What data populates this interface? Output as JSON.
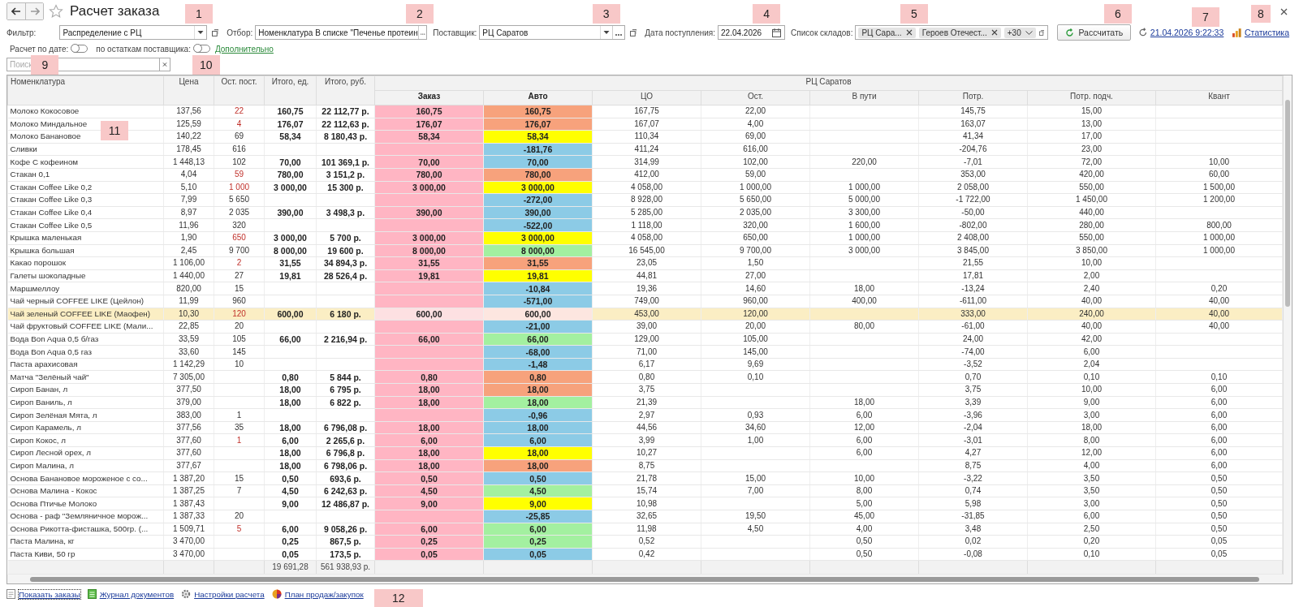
{
  "window": {
    "title": "Расчет заказа"
  },
  "filters": [
    {
      "label": "Фильтр:",
      "value": "Распределение с РЦ",
      "kind": "select"
    },
    {
      "label": "Отбор:",
      "value": "Номенклатура В списке \"Печенье протеин",
      "kind": "picker"
    },
    {
      "label": "Поставщик:",
      "value": "РЦ Саратов",
      "kind": "select_picker"
    },
    {
      "label": "Дата поступления:",
      "value": "22.04.2026",
      "kind": "date"
    }
  ],
  "warehouses": {
    "label": "Список складов:",
    "tags": [
      "РЦ Сара...",
      "Героев Отечест..."
    ],
    "more": "+30"
  },
  "calculate_button": "Рассчитать",
  "last_calc": "21.04.2026 9:22:33",
  "statistics_link": "Статистика",
  "options": [
    {
      "label": "Расчет по дате:",
      "on": false
    },
    {
      "label": "по остаткам поставщика:",
      "on": false
    }
  ],
  "more_link": "Дополнительно",
  "search": {
    "placeholder": "Поиск"
  },
  "table": {
    "columns": [
      "Номенклатура",
      "Цена",
      "Ост. пост.",
      "Итого, ед.",
      "Итого, руб.",
      "Заказ",
      "Авто",
      "ЦО",
      "Ост.",
      "В пути",
      "Потр.",
      "Потр. подч.",
      "Квант"
    ],
    "group": "РЦ Саратов",
    "rows": [
      {
        "name": "Молоко Кокосовое",
        "price": "137,56",
        "stock": {
          "text": "22",
          "low": true
        },
        "qty": "160,75",
        "sum": "22 112,77 р.",
        "order": "160,75",
        "auto": {
          "text": "160,75",
          "color": "#f7a27c"
        },
        "co": "167,75",
        "rest": "22,00",
        "need": "145,75",
        "need_sub": "15,00",
        "selected": false
      },
      {
        "name": "Молоко Миндальное",
        "price": "125,59",
        "stock": {
          "text": "4",
          "low": true
        },
        "qty": "176,07",
        "sum": "22 112,63 р.",
        "order": "176,07",
        "auto": {
          "text": "176,07",
          "color": "#f7a27c"
        },
        "co": "167,07",
        "rest": "4,00",
        "need": "163,07",
        "need_sub": "13,00",
        "selected": false
      },
      {
        "name": "Молоко Банановое",
        "price": "140,22",
        "stock": {
          "text": "69",
          "low": false
        },
        "qty": "58,34",
        "sum": "8 180,43 р.",
        "order": "58,34",
        "auto": {
          "text": "58,34",
          "color": "#ffff00"
        },
        "co": "110,34",
        "rest": "69,00",
        "need": "41,34",
        "need_sub": "17,00",
        "selected": false
      },
      {
        "name": "Сливки",
        "price": "178,45",
        "stock": {
          "text": "616",
          "low": false
        },
        "auto": {
          "text": "-181,76",
          "color": "#8ccbe6"
        },
        "co": "411,24",
        "rest": "616,00",
        "need": "-204,76",
        "need_sub": "23,00",
        "selected": false
      },
      {
        "name": "Кофе С кофеином",
        "price": "1 448,13",
        "stock": {
          "text": "102",
          "low": false
        },
        "qty": "70,00",
        "sum": "101 369,1 р.",
        "order": "70,00",
        "auto": {
          "text": "70,00",
          "color": "#8ccbe6"
        },
        "co": "314,99",
        "rest": "102,00",
        "transit": "220,00",
        "need": "-7,01",
        "need_sub": "72,00",
        "quant": "10,00",
        "selected": false
      },
      {
        "name": "Стакан 0,1",
        "price": "4,04",
        "stock": {
          "text": "59",
          "low": true
        },
        "qty": "780,00",
        "sum": "3 151,2 р.",
        "order": "780,00",
        "auto": {
          "text": "780,00",
          "color": "#f7a27c"
        },
        "co": "412,00",
        "rest": "59,00",
        "need": "353,00",
        "need_sub": "420,00",
        "quant": "60,00",
        "selected": false
      },
      {
        "name": "Стакан Coffee Like 0,2",
        "price": "5,10",
        "stock": {
          "text": "1 000",
          "low": true
        },
        "qty": "3 000,00",
        "sum": "15 300 р.",
        "order": "3 000,00",
        "auto": {
          "text": "3 000,00",
          "color": "#ffff00"
        },
        "co": "4 058,00",
        "rest": "1 000,00",
        "transit": "1 000,00",
        "need": "2 058,00",
        "need_sub": "550,00",
        "quant": "1 500,00",
        "selected": false
      },
      {
        "name": "Стакан Coffee Like 0,3",
        "price": "7,99",
        "stock": {
          "text": "5 650",
          "low": false
        },
        "auto": {
          "text": "-272,00",
          "color": "#8ccbe6"
        },
        "co": "8 928,00",
        "rest": "5 650,00",
        "transit": "5 000,00",
        "need": "-1 722,00",
        "need_sub": "1 450,00",
        "quant": "1 200,00",
        "selected": false
      },
      {
        "name": "Стакан Coffee Like 0,4",
        "price": "8,97",
        "stock": {
          "text": "2 035",
          "low": false
        },
        "qty": "390,00",
        "sum": "3 498,3 р.",
        "order": "390,00",
        "auto": {
          "text": "390,00",
          "color": "#8ccbe6"
        },
        "co": "5 285,00",
        "rest": "2 035,00",
        "transit": "3 300,00",
        "need": "-50,00",
        "need_sub": "440,00",
        "selected": false
      },
      {
        "name": "Стакан Coffee Like 0,5",
        "price": "11,96",
        "stock": {
          "text": "320",
          "low": false
        },
        "auto": {
          "text": "-522,00",
          "color": "#8ccbe6"
        },
        "co": "1 118,00",
        "rest": "320,00",
        "transit": "1 600,00",
        "need": "-802,00",
        "need_sub": "280,00",
        "quant": "800,00",
        "selected": false
      },
      {
        "name": "Крышка маленькая",
        "price": "1,90",
        "stock": {
          "text": "650",
          "low": true
        },
        "qty": "3 000,00",
        "sum": "5 700 р.",
        "order": "3 000,00",
        "auto": {
          "text": "3 000,00",
          "color": "#ffff00"
        },
        "co": "4 058,00",
        "rest": "650,00",
        "transit": "1 000,00",
        "need": "2 408,00",
        "need_sub": "550,00",
        "quant": "1 000,00",
        "selected": false
      },
      {
        "name": "Крышка большая",
        "price": "2,45",
        "stock": {
          "text": "9 700",
          "low": false
        },
        "qty": "8 000,00",
        "sum": "19 600 р.",
        "order": "8 000,00",
        "auto": {
          "text": "8 000,00",
          "color": "#a3f0a0"
        },
        "co": "16 545,00",
        "rest": "9 700,00",
        "transit": "3 000,00",
        "need": "3 845,00",
        "need_sub": "3 850,00",
        "quant": "1 000,00",
        "selected": false
      },
      {
        "name": "Какао порошок",
        "price": "1 106,00",
        "stock": {
          "text": "2",
          "low": true
        },
        "qty": "31,55",
        "sum": "34 894,3 р.",
        "order": "31,55",
        "auto": {
          "text": "31,55",
          "color": "#f7a27c"
        },
        "co": "23,05",
        "rest": "1,50",
        "need": "21,55",
        "need_sub": "10,00",
        "selected": false
      },
      {
        "name": "Галеты шоколадные",
        "price": "1 440,00",
        "stock": {
          "text": "27",
          "low": false
        },
        "qty": "19,81",
        "sum": "28 526,4 р.",
        "order": "19,81",
        "auto": {
          "text": "19,81",
          "color": "#ffff00"
        },
        "co": "44,81",
        "rest": "27,00",
        "need": "17,81",
        "need_sub": "2,00",
        "selected": false
      },
      {
        "name": "Маршмеллоу",
        "price": "820,00",
        "stock": {
          "text": "15",
          "low": false
        },
        "auto": {
          "text": "-10,84",
          "color": "#8ccbe6"
        },
        "co": "19,36",
        "rest": "14,60",
        "transit": "18,00",
        "need": "-13,24",
        "need_sub": "2,40",
        "quant": "0,20",
        "selected": false
      },
      {
        "name": "Чай черный COFFEE LIKE (Цейлон)",
        "price": "11,99",
        "stock": {
          "text": "960",
          "low": false
        },
        "auto": {
          "text": "-571,00",
          "color": "#8ccbe6"
        },
        "co": "749,00",
        "rest": "960,00",
        "transit": "400,00",
        "need": "-611,00",
        "need_sub": "40,00",
        "quant": "40,00",
        "selected": false
      },
      {
        "name": "Чай зеленый COFFEE LIKE (Маофен)",
        "price": "10,30",
        "stock": {
          "text": "120",
          "low": true
        },
        "qty": "600,00",
        "sum": "6 180 р.",
        "order": "600,00",
        "auto": {
          "text": "600,00"
        },
        "co": "453,00",
        "rest": "120,00",
        "need": "333,00",
        "need_sub": "240,00",
        "quant": "40,00",
        "selected": true
      },
      {
        "name": "Чай фруктовый COFFEE LIKE (Мали...",
        "price": "22,85",
        "stock": {
          "text": "20",
          "low": false
        },
        "auto": {
          "text": "-21,00",
          "color": "#8ccbe6"
        },
        "co": "39,00",
        "rest": "20,00",
        "transit": "80,00",
        "need": "-61,00",
        "need_sub": "40,00",
        "quant": "40,00",
        "selected": false
      },
      {
        "name": "Вода Bon Aqua 0,5 б/газ",
        "price": "33,59",
        "stock": {
          "text": "105",
          "low": false
        },
        "qty": "66,00",
        "sum": "2 216,94 р.",
        "order": "66,00",
        "auto": {
          "text": "66,00",
          "color": "#a3f0a0"
        },
        "co": "129,00",
        "rest": "105,00",
        "need": "24,00",
        "need_sub": "42,00",
        "selected": false
      },
      {
        "name": "Вода Bon Aqua 0,5 газ",
        "price": "33,60",
        "stock": {
          "text": "145",
          "low": false
        },
        "auto": {
          "text": "-68,00",
          "color": "#8ccbe6"
        },
        "co": "71,00",
        "rest": "145,00",
        "need": "-74,00",
        "need_sub": "6,00",
        "selected": false
      },
      {
        "name": "Паста арахисовая",
        "price": "1 142,29",
        "stock": {
          "text": "10",
          "low": false
        },
        "auto": {
          "text": "-1,48",
          "color": "#8ccbe6"
        },
        "co": "6,17",
        "rest": "9,69",
        "need": "-3,52",
        "need_sub": "2,04",
        "selected": false
      },
      {
        "name": "Матча \"Зелёный чай\"",
        "price": "7 305,00",
        "qty": "0,80",
        "sum": "5 844 р.",
        "order": "0,80",
        "auto": {
          "text": "0,80",
          "color": "#f7a27c"
        },
        "co": "0,80",
        "rest": "0,10",
        "need": "0,70",
        "need_sub": "0,10",
        "quant": "0,10",
        "selected": false
      },
      {
        "name": "Сироп Банан, л",
        "price": "377,50",
        "qty": "18,00",
        "sum": "6 795 р.",
        "order": "18,00",
        "auto": {
          "text": "18,00",
          "color": "#f7a27c"
        },
        "co": "3,75",
        "need": "3,75",
        "need_sub": "10,00",
        "quant": "6,00",
        "selected": false
      },
      {
        "name": "Сироп Ваниль, л",
        "price": "379,00",
        "qty": "18,00",
        "sum": "6 822 р.",
        "order": "18,00",
        "auto": {
          "text": "18,00",
          "color": "#a3f0a0"
        },
        "co": "21,39",
        "transit": "18,00",
        "need": "3,39",
        "need_sub": "9,00",
        "quant": "6,00",
        "selected": false
      },
      {
        "name": "Сироп Зелёная Мята, л",
        "price": "383,00",
        "stock": {
          "text": "1",
          "low": false
        },
        "auto": {
          "text": "-0,96",
          "color": "#8ccbe6"
        },
        "co": "2,97",
        "rest": "0,93",
        "transit": "6,00",
        "need": "-3,96",
        "need_sub": "3,00",
        "quant": "6,00",
        "selected": false
      },
      {
        "name": "Сироп Карамель, л",
        "price": "377,56",
        "stock": {
          "text": "35",
          "low": false
        },
        "qty": "18,00",
        "sum": "6 796,08 р.",
        "order": "18,00",
        "auto": {
          "text": "18,00",
          "color": "#8ccbe6"
        },
        "co": "44,56",
        "rest": "34,60",
        "transit": "12,00",
        "need": "-2,04",
        "need_sub": "18,00",
        "quant": "6,00",
        "selected": false
      },
      {
        "name": "Сироп Кокос, л",
        "price": "377,60",
        "stock": {
          "text": "1",
          "low": true
        },
        "qty": "6,00",
        "sum": "2 265,6 р.",
        "order": "6,00",
        "auto": {
          "text": "6,00",
          "color": "#8ccbe6"
        },
        "co": "3,99",
        "rest": "1,00",
        "transit": "6,00",
        "need": "-3,01",
        "need_sub": "8,00",
        "quant": "6,00",
        "selected": false
      },
      {
        "name": "Сироп Лесной орех, л",
        "price": "377,60",
        "qty": "18,00",
        "sum": "6 796,8 р.",
        "order": "18,00",
        "auto": {
          "text": "18,00",
          "color": "#ffff00"
        },
        "co": "10,27",
        "transit": "6,00",
        "need": "4,27",
        "need_sub": "12,00",
        "quant": "6,00",
        "selected": false
      },
      {
        "name": "Сироп Малина, л",
        "price": "377,67",
        "qty": "18,00",
        "sum": "6 798,06 р.",
        "order": "18,00",
        "auto": {
          "text": "18,00",
          "color": "#f7a27c"
        },
        "co": "8,75",
        "need": "8,75",
        "need_sub": "4,00",
        "quant": "6,00",
        "selected": false
      },
      {
        "name": "Основа Банановое мороженое с со...",
        "price": "1 387,20",
        "stock": {
          "text": "15",
          "low": false
        },
        "qty": "0,50",
        "sum": "693,6 р.",
        "order": "0,50",
        "auto": {
          "text": "0,50",
          "color": "#8ccbe6"
        },
        "co": "21,78",
        "rest": "15,00",
        "transit": "10,00",
        "need": "-3,22",
        "need_sub": "3,50",
        "quant": "0,50",
        "selected": false
      },
      {
        "name": "Основа Малина - Кокос",
        "price": "1 387,25",
        "stock": {
          "text": "7",
          "low": false
        },
        "qty": "4,50",
        "sum": "6 242,63 р.",
        "order": "4,50",
        "auto": {
          "text": "4,50",
          "color": "#a3f0a0"
        },
        "co": "15,74",
        "rest": "7,00",
        "transit": "8,00",
        "need": "0,74",
        "need_sub": "3,50",
        "quant": "0,50",
        "selected": false
      },
      {
        "name": "Основа Птичье Молоко",
        "price": "1 387,43",
        "qty": "9,00",
        "sum": "12 486,87 р.",
        "order": "9,00",
        "auto": {
          "text": "9,00",
          "color": "#ffff00"
        },
        "co": "10,98",
        "transit": "5,00",
        "need": "5,98",
        "need_sub": "3,00",
        "quant": "0,50",
        "selected": false
      },
      {
        "name": "Основа - раф \"Земляничное морож...",
        "price": "1 387,33",
        "stock": {
          "text": "20",
          "low": false
        },
        "auto": {
          "text": "-25,85",
          "color": "#8ccbe6"
        },
        "co": "32,65",
        "rest": "19,50",
        "transit": "45,00",
        "need": "-31,85",
        "need_sub": "6,00",
        "quant": "0,50",
        "selected": false
      },
      {
        "name": "Основа Рикотта-фисташка, 500гр. (...",
        "price": "1 509,71",
        "stock": {
          "text": "5",
          "low": true
        },
        "qty": "6,00",
        "sum": "9 058,26 р.",
        "order": "6,00",
        "auto": {
          "text": "6,00",
          "color": "#a3f0a0"
        },
        "co": "11,98",
        "rest": "4,50",
        "transit": "4,00",
        "need": "3,48",
        "need_sub": "2,50",
        "quant": "0,50",
        "selected": false
      },
      {
        "name": "Паста Малина, кг",
        "price": "3 470,00",
        "qty": "0,25",
        "sum": "867,5 р.",
        "order": "0,25",
        "auto": {
          "text": "0,25",
          "color": "#a3f0a0"
        },
        "co": "0,52",
        "transit": "0,50",
        "need": "0,02",
        "need_sub": "0,20",
        "quant": "0,05",
        "selected": false
      },
      {
        "name": "Паста Киви, 50 гр",
        "price": "3 470,00",
        "qty": "0,05",
        "sum": "173,5 р.",
        "order": "0,05",
        "auto": {
          "text": "0,05",
          "color": "#8ccbe6"
        },
        "co": "0,42",
        "transit": "0,50",
        "need": "-0,08",
        "need_sub": "0,10",
        "quant": "0,05",
        "selected": false
      }
    ],
    "totals": {
      "qty": "19 691,28",
      "sum": "561 938,93 р."
    }
  },
  "footer_links": [
    {
      "label": "Показать заказы",
      "kind": "orders"
    },
    {
      "label": "Журнал документов",
      "kind": "journal"
    },
    {
      "label": "Настройки расчета",
      "kind": "settings"
    },
    {
      "label": "План продаж/закупок",
      "kind": "plan"
    }
  ],
  "markers": [
    "1",
    "2",
    "3",
    "4",
    "5",
    "6",
    "7",
    "8",
    "9",
    "10",
    "11",
    "12"
  ]
}
